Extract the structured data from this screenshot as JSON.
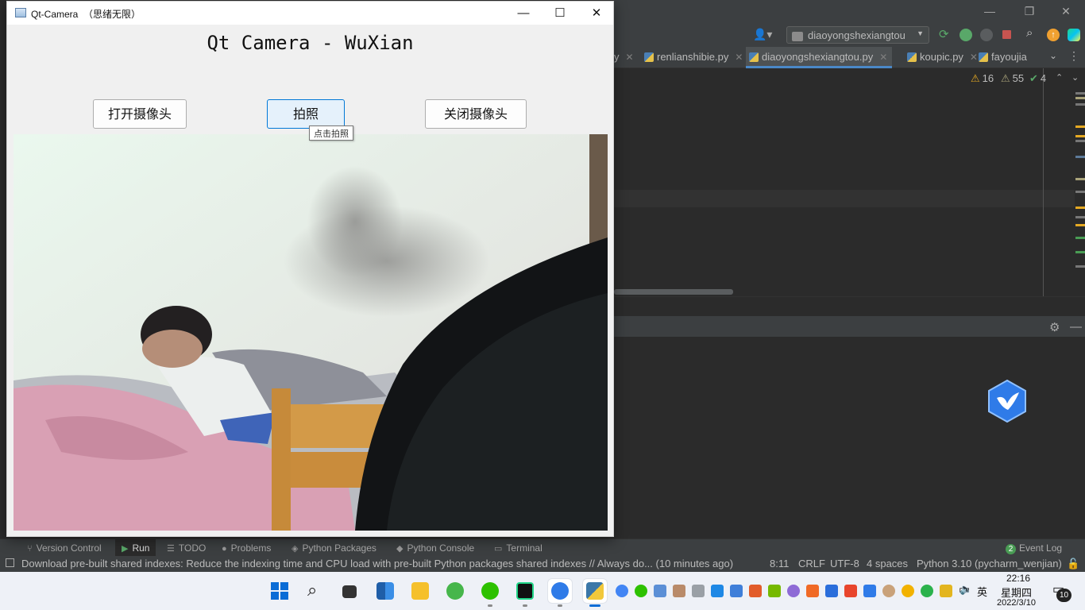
{
  "qt_window": {
    "title": "Qt-Camera  （思绪无限）",
    "heading": "Qt Camera - WuXian",
    "buttons": {
      "open_camera": "打开摄像头",
      "take_photo": "拍照",
      "close_camera": "关闭摄像头"
    },
    "tooltip": "点击拍照"
  },
  "ide": {
    "run_config": "diaoyongshexiangtou",
    "tabs": [
      {
        "label": "y"
      },
      {
        "label": "renlianshibie.py"
      },
      {
        "label": "diaoyongshexiangtou.py",
        "active": true
      },
      {
        "label": "koupic.py"
      },
      {
        "label": "fayoujia"
      }
    ],
    "inspections": {
      "warnings": "16",
      "weak_warnings": "55",
      "ok": "4"
    },
    "tool_tabs": [
      {
        "label": "Version Control",
        "icon": "branch-icon"
      },
      {
        "label": "Run",
        "icon": "play-icon",
        "active": true
      },
      {
        "label": "TODO",
        "icon": "list-icon"
      },
      {
        "label": "Problems",
        "icon": "info-icon"
      },
      {
        "label": "Python Packages",
        "icon": "layers-icon"
      },
      {
        "label": "Python Console",
        "icon": "python-icon"
      },
      {
        "label": "Terminal",
        "icon": "terminal-icon"
      }
    ],
    "event_log": {
      "count": "2",
      "label": "Event Log"
    },
    "status": {
      "message": "Download pre-built shared indexes: Reduce the indexing time and CPU load with pre-built Python packages shared indexes // Always do... (10 minutes ago)",
      "position": "8:11",
      "line_sep": "CRLF",
      "encoding": "UTF-8",
      "indent": "4 spaces",
      "interpreter": "Python 3.10 (pycharm_wenjian)"
    }
  },
  "taskbar": {
    "ime": "英",
    "time": "22:16",
    "weekday": "星期四",
    "date": "2022/3/10",
    "notifications": "10"
  },
  "colors": {
    "ide_bg": "#2b2b2b",
    "ide_panel": "#3c3f41",
    "accent": "#0078d7",
    "warning": "#e5a923",
    "ok": "#499c54"
  }
}
